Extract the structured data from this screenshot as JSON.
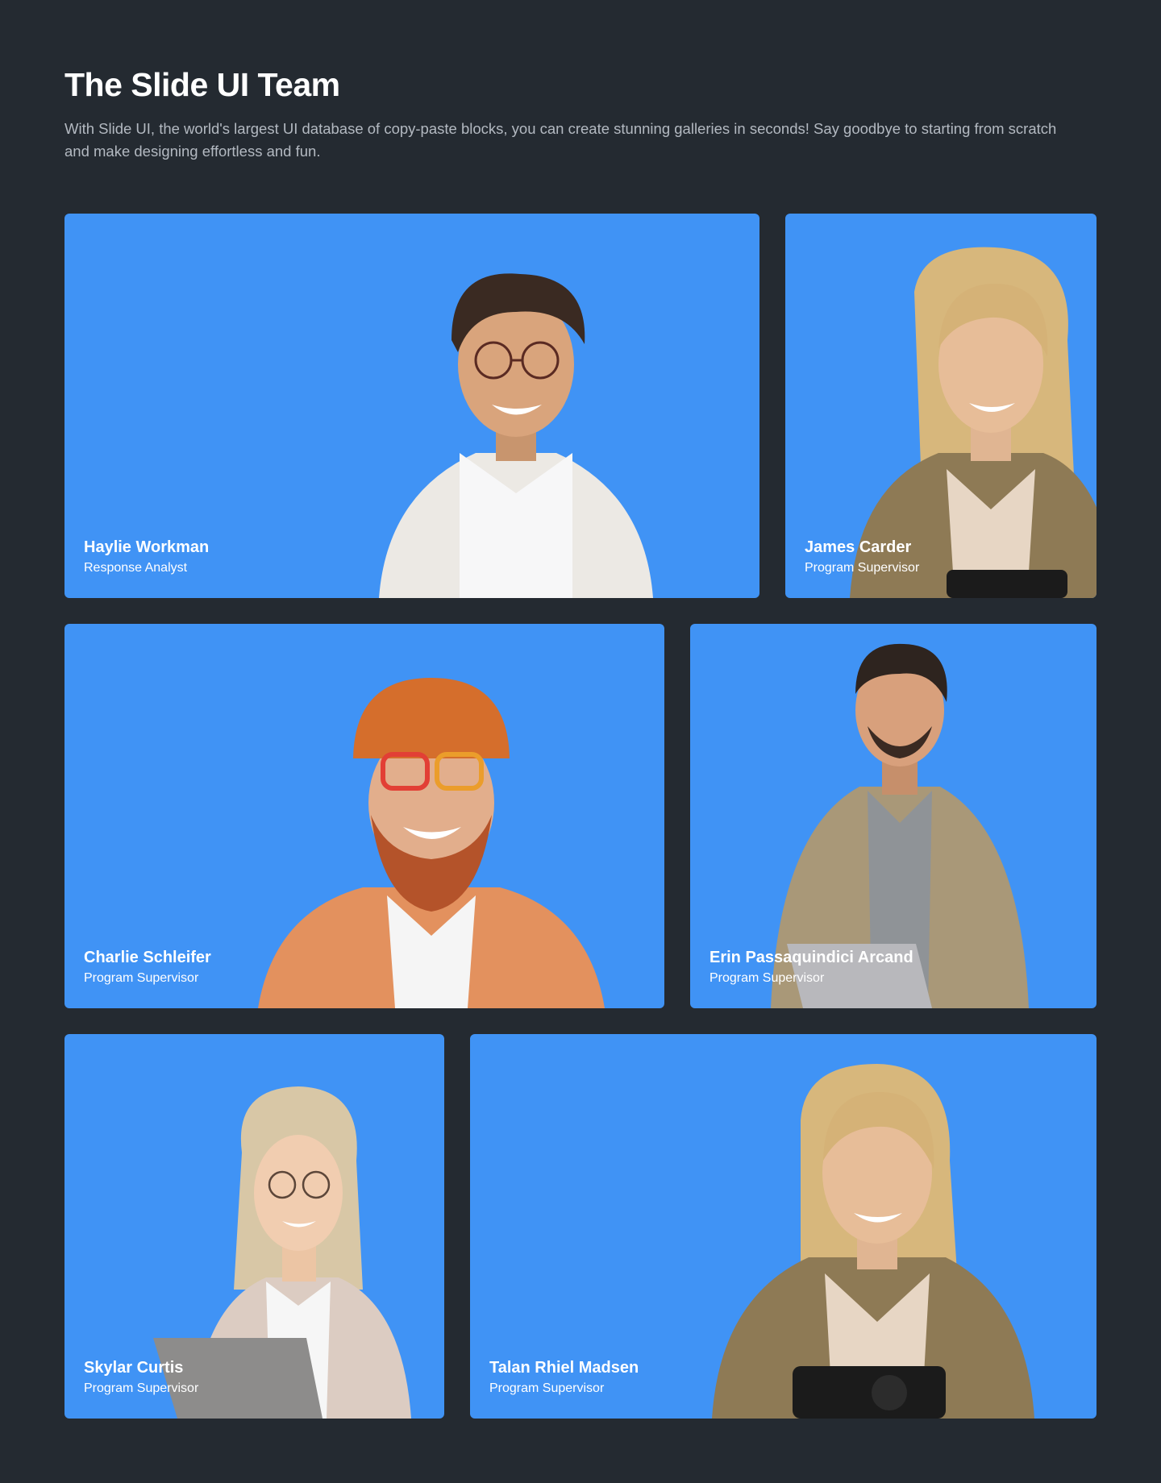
{
  "page": {
    "title": "The Slide UI Team",
    "description": "With Slide UI, the world's largest UI database of copy-paste blocks, you can create stunning galleries in seconds! Say goodbye to starting from scratch and make designing effortless and fun."
  },
  "colors": {
    "background": "#242a31",
    "card": "#4093f5",
    "title": "#ffffff",
    "description": "#b3b9c1"
  },
  "team": [
    {
      "name": "Haylie Workman",
      "role": "Response Analyst"
    },
    {
      "name": "James Carder",
      "role": "Program Supervisor"
    },
    {
      "name": "Charlie Schleifer",
      "role": "Program Supervisor"
    },
    {
      "name": "Erin Passaquindici Arcand",
      "role": "Program Supervisor"
    },
    {
      "name": "Skylar Curtis",
      "role": "Program Supervisor"
    },
    {
      "name": "Talan Rhiel Madsen",
      "role": "Program Supervisor"
    }
  ]
}
